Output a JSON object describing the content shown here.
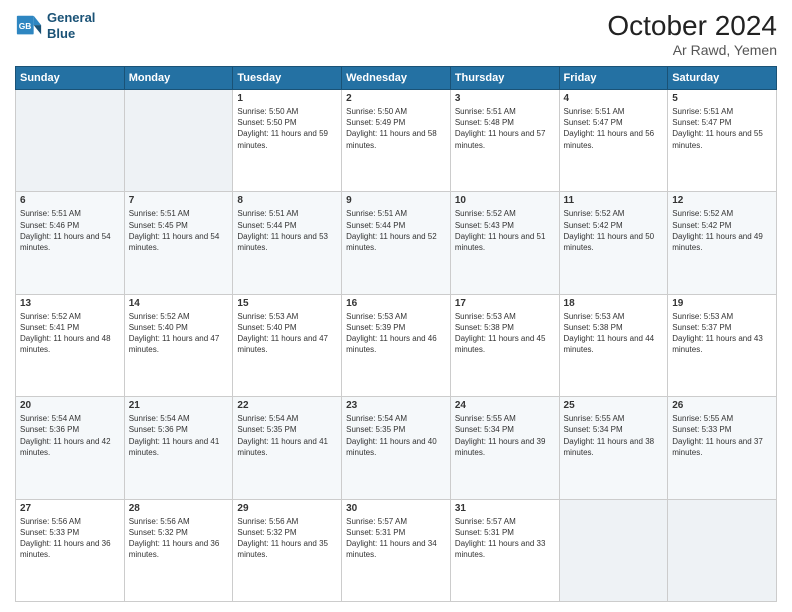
{
  "header": {
    "logo_line1": "General",
    "logo_line2": "Blue",
    "month": "October 2024",
    "location": "Ar Rawd, Yemen"
  },
  "weekdays": [
    "Sunday",
    "Monday",
    "Tuesday",
    "Wednesday",
    "Thursday",
    "Friday",
    "Saturday"
  ],
  "weeks": [
    [
      {
        "day": "",
        "sunrise": "",
        "sunset": "",
        "daylight": ""
      },
      {
        "day": "",
        "sunrise": "",
        "sunset": "",
        "daylight": ""
      },
      {
        "day": "1",
        "sunrise": "Sunrise: 5:50 AM",
        "sunset": "Sunset: 5:50 PM",
        "daylight": "Daylight: 11 hours and 59 minutes."
      },
      {
        "day": "2",
        "sunrise": "Sunrise: 5:50 AM",
        "sunset": "Sunset: 5:49 PM",
        "daylight": "Daylight: 11 hours and 58 minutes."
      },
      {
        "day": "3",
        "sunrise": "Sunrise: 5:51 AM",
        "sunset": "Sunset: 5:48 PM",
        "daylight": "Daylight: 11 hours and 57 minutes."
      },
      {
        "day": "4",
        "sunrise": "Sunrise: 5:51 AM",
        "sunset": "Sunset: 5:47 PM",
        "daylight": "Daylight: 11 hours and 56 minutes."
      },
      {
        "day": "5",
        "sunrise": "Sunrise: 5:51 AM",
        "sunset": "Sunset: 5:47 PM",
        "daylight": "Daylight: 11 hours and 55 minutes."
      }
    ],
    [
      {
        "day": "6",
        "sunrise": "Sunrise: 5:51 AM",
        "sunset": "Sunset: 5:46 PM",
        "daylight": "Daylight: 11 hours and 54 minutes."
      },
      {
        "day": "7",
        "sunrise": "Sunrise: 5:51 AM",
        "sunset": "Sunset: 5:45 PM",
        "daylight": "Daylight: 11 hours and 54 minutes."
      },
      {
        "day": "8",
        "sunrise": "Sunrise: 5:51 AM",
        "sunset": "Sunset: 5:44 PM",
        "daylight": "Daylight: 11 hours and 53 minutes."
      },
      {
        "day": "9",
        "sunrise": "Sunrise: 5:51 AM",
        "sunset": "Sunset: 5:44 PM",
        "daylight": "Daylight: 11 hours and 52 minutes."
      },
      {
        "day": "10",
        "sunrise": "Sunrise: 5:52 AM",
        "sunset": "Sunset: 5:43 PM",
        "daylight": "Daylight: 11 hours and 51 minutes."
      },
      {
        "day": "11",
        "sunrise": "Sunrise: 5:52 AM",
        "sunset": "Sunset: 5:42 PM",
        "daylight": "Daylight: 11 hours and 50 minutes."
      },
      {
        "day": "12",
        "sunrise": "Sunrise: 5:52 AM",
        "sunset": "Sunset: 5:42 PM",
        "daylight": "Daylight: 11 hours and 49 minutes."
      }
    ],
    [
      {
        "day": "13",
        "sunrise": "Sunrise: 5:52 AM",
        "sunset": "Sunset: 5:41 PM",
        "daylight": "Daylight: 11 hours and 48 minutes."
      },
      {
        "day": "14",
        "sunrise": "Sunrise: 5:52 AM",
        "sunset": "Sunset: 5:40 PM",
        "daylight": "Daylight: 11 hours and 47 minutes."
      },
      {
        "day": "15",
        "sunrise": "Sunrise: 5:53 AM",
        "sunset": "Sunset: 5:40 PM",
        "daylight": "Daylight: 11 hours and 47 minutes."
      },
      {
        "day": "16",
        "sunrise": "Sunrise: 5:53 AM",
        "sunset": "Sunset: 5:39 PM",
        "daylight": "Daylight: 11 hours and 46 minutes."
      },
      {
        "day": "17",
        "sunrise": "Sunrise: 5:53 AM",
        "sunset": "Sunset: 5:38 PM",
        "daylight": "Daylight: 11 hours and 45 minutes."
      },
      {
        "day": "18",
        "sunrise": "Sunrise: 5:53 AM",
        "sunset": "Sunset: 5:38 PM",
        "daylight": "Daylight: 11 hours and 44 minutes."
      },
      {
        "day": "19",
        "sunrise": "Sunrise: 5:53 AM",
        "sunset": "Sunset: 5:37 PM",
        "daylight": "Daylight: 11 hours and 43 minutes."
      }
    ],
    [
      {
        "day": "20",
        "sunrise": "Sunrise: 5:54 AM",
        "sunset": "Sunset: 5:36 PM",
        "daylight": "Daylight: 11 hours and 42 minutes."
      },
      {
        "day": "21",
        "sunrise": "Sunrise: 5:54 AM",
        "sunset": "Sunset: 5:36 PM",
        "daylight": "Daylight: 11 hours and 41 minutes."
      },
      {
        "day": "22",
        "sunrise": "Sunrise: 5:54 AM",
        "sunset": "Sunset: 5:35 PM",
        "daylight": "Daylight: 11 hours and 41 minutes."
      },
      {
        "day": "23",
        "sunrise": "Sunrise: 5:54 AM",
        "sunset": "Sunset: 5:35 PM",
        "daylight": "Daylight: 11 hours and 40 minutes."
      },
      {
        "day": "24",
        "sunrise": "Sunrise: 5:55 AM",
        "sunset": "Sunset: 5:34 PM",
        "daylight": "Daylight: 11 hours and 39 minutes."
      },
      {
        "day": "25",
        "sunrise": "Sunrise: 5:55 AM",
        "sunset": "Sunset: 5:34 PM",
        "daylight": "Daylight: 11 hours and 38 minutes."
      },
      {
        "day": "26",
        "sunrise": "Sunrise: 5:55 AM",
        "sunset": "Sunset: 5:33 PM",
        "daylight": "Daylight: 11 hours and 37 minutes."
      }
    ],
    [
      {
        "day": "27",
        "sunrise": "Sunrise: 5:56 AM",
        "sunset": "Sunset: 5:33 PM",
        "daylight": "Daylight: 11 hours and 36 minutes."
      },
      {
        "day": "28",
        "sunrise": "Sunrise: 5:56 AM",
        "sunset": "Sunset: 5:32 PM",
        "daylight": "Daylight: 11 hours and 36 minutes."
      },
      {
        "day": "29",
        "sunrise": "Sunrise: 5:56 AM",
        "sunset": "Sunset: 5:32 PM",
        "daylight": "Daylight: 11 hours and 35 minutes."
      },
      {
        "day": "30",
        "sunrise": "Sunrise: 5:57 AM",
        "sunset": "Sunset: 5:31 PM",
        "daylight": "Daylight: 11 hours and 34 minutes."
      },
      {
        "day": "31",
        "sunrise": "Sunrise: 5:57 AM",
        "sunset": "Sunset: 5:31 PM",
        "daylight": "Daylight: 11 hours and 33 minutes."
      },
      {
        "day": "",
        "sunrise": "",
        "sunset": "",
        "daylight": ""
      },
      {
        "day": "",
        "sunrise": "",
        "sunset": "",
        "daylight": ""
      }
    ]
  ]
}
